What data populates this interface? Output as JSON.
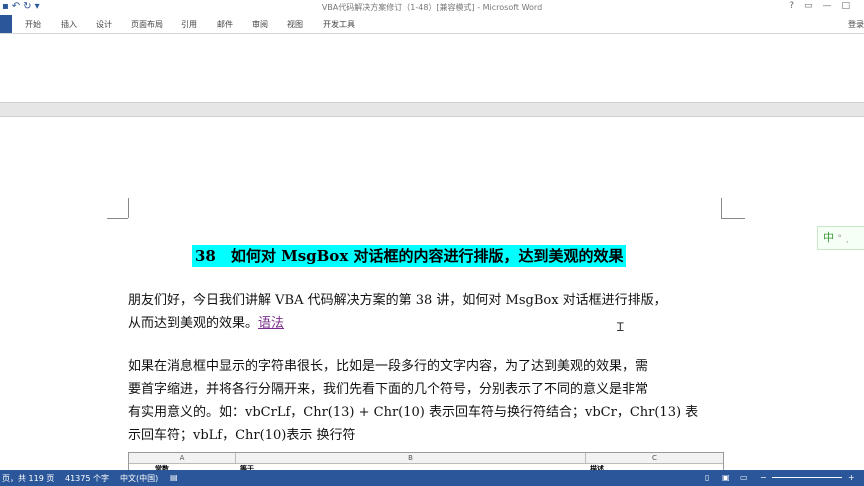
{
  "window": {
    "title": "VBA代码解决方案修订（1-48）[兼容模式] - Microsoft Word",
    "controls": [
      "?",
      "▭",
      "—",
      "□"
    ]
  },
  "ribbon": {
    "tabs": [
      "开始",
      "插入",
      "设计",
      "页面布局",
      "引用",
      "邮件",
      "审阅",
      "视图",
      "开发工具"
    ],
    "login": "登录"
  },
  "document": {
    "heading": "38　如何对 MsgBox 对话框的内容进行排版，达到美观的效果",
    "para1_lines": [
      "朋友们好，今日我们讲解 VBA 代码解决方案的第 38 讲，如何对 MsgBox 对话框进行排版，",
      "从而达到美观的效果。"
    ],
    "para1_link": "语法",
    "para2_lines": [
      "如果在消息框中显示的字符串很长，比如是一段多行的文字内容，为了达到美观的效果，需",
      "要首字缩进，并将各行分隔开来，我们先看下面的几个符号，分别表示了不同的意义是非常",
      "有实用意义的。如：vbCrLf，Chr(13) + Chr(10) 表示回车符与换行符结合；vbCr，Chr(13) 表",
      "示回车符；vbLf，Chr(10)表示  换行符"
    ],
    "table": {
      "column_headers": [
        "A",
        "B",
        "C"
      ],
      "first_row": [
        "常数",
        "等于",
        "描述"
      ]
    }
  },
  "ime": {
    "label": "中",
    "extras": "° ¸"
  },
  "status_bar": {
    "page": "页，共 119 页",
    "words": "41375 个字",
    "language": "中文(中国)"
  },
  "colors": {
    "accent": "#2b579a",
    "highlight": "#00ffff",
    "link": "#7a2d8a"
  }
}
